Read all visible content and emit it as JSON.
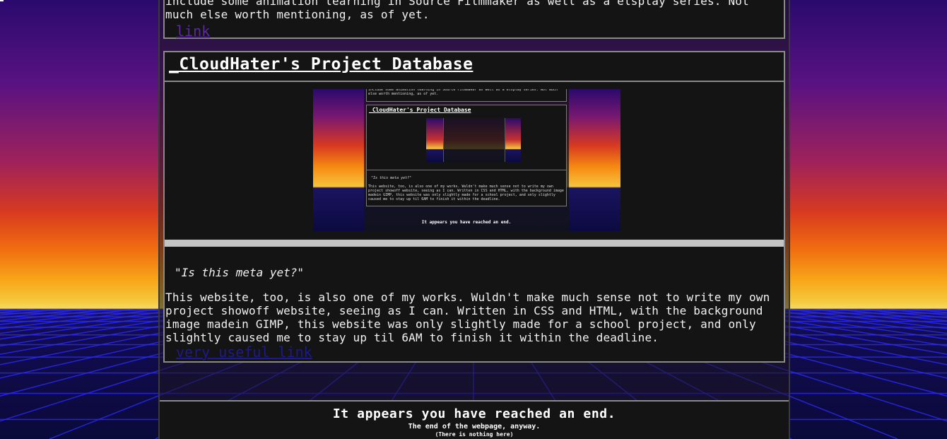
{
  "prev_project": {
    "description": "include some animation learning in Source Filmmaker as well as a elsplay series. Not much else worth mentioning, as of yet.",
    "link_label": "link"
  },
  "project": {
    "title": "_CloudHater's Project Database",
    "quote": "\"Is this meta yet?\"",
    "description": "This website, too, is also one of my works. Wuldn't make much sense not to write my own project showoff website, seeing as I can. Written in CSS and HTML, with the background image madein GIMP, this website was only slightly made for a school project, and only slightly caused me to stay up til 6AM to finish it within the deadline.",
    "link_label": "very useful link"
  },
  "footer": {
    "title": "It appears you have reached an end.",
    "subtitle": "The end of the webpage, anyway.",
    "note": "(There is nothing here)"
  },
  "colors": {
    "link_visited": "#5c2aa0",
    "link": "#1e1a8a",
    "card_bg": "#141414",
    "card_border": "#8a8a8a",
    "grid_line": "#2a2aff"
  }
}
